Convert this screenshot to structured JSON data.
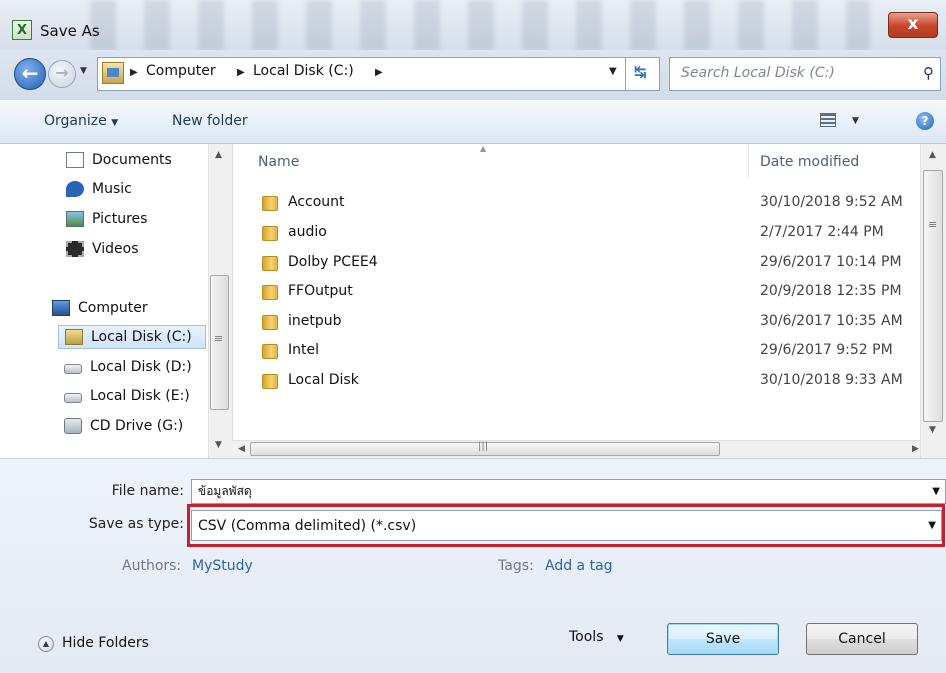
{
  "window": {
    "title": "Save As",
    "app_icon": "excel-icon",
    "close_glyph": "x"
  },
  "address": {
    "crumbs": [
      "Computer",
      "Local Disk (C:)"
    ],
    "search_placeholder": "Search Local Disk (C:)"
  },
  "toolbar": {
    "organize_label": "Organize",
    "new_folder_label": "New folder"
  },
  "navpane": {
    "libraries": [
      {
        "label": "Documents",
        "icon": "documents-icon"
      },
      {
        "label": "Music",
        "icon": "music-icon"
      },
      {
        "label": "Pictures",
        "icon": "pictures-icon"
      },
      {
        "label": "Videos",
        "icon": "videos-icon"
      }
    ],
    "computer_label": "Computer",
    "drives": [
      {
        "label": "Local Disk (C:)",
        "icon": "local-disk-icon",
        "selected": true
      },
      {
        "label": "Local Disk (D:)",
        "icon": "drive-icon",
        "selected": false
      },
      {
        "label": "Local Disk (E:)",
        "icon": "drive-icon",
        "selected": false
      },
      {
        "label": "CD Drive (G:)",
        "icon": "cd-drive-icon",
        "selected": false
      }
    ]
  },
  "filelist": {
    "columns": {
      "name": "Name",
      "date_modified": "Date modified"
    },
    "rows": [
      {
        "name": "Account",
        "date": "30/10/2018 9:52 AM"
      },
      {
        "name": "audio",
        "date": "2/7/2017 2:44 PM"
      },
      {
        "name": "Dolby PCEE4",
        "date": "29/6/2017 10:14 PM"
      },
      {
        "name": "FFOutput",
        "date": "20/9/2018 12:35 PM"
      },
      {
        "name": "inetpub",
        "date": "30/6/2017 10:35 AM"
      },
      {
        "name": "Intel",
        "date": "29/6/2017 9:52 PM"
      },
      {
        "name": "Local Disk",
        "date": "30/10/2018 9:33 AM"
      }
    ]
  },
  "form": {
    "file_name_label": "File name:",
    "file_name_value": "ข้อมูลพัสดุ",
    "save_type_label": "Save as type:",
    "save_type_value": "CSV (Comma delimited) (*.csv)",
    "authors_label": "Authors:",
    "authors_value": "MyStudy",
    "tags_label": "Tags:",
    "tags_value": "Add a tag"
  },
  "footer": {
    "hide_folders_label": "Hide Folders",
    "tools_label": "Tools",
    "save_label": "Save",
    "cancel_label": "Cancel"
  },
  "colors": {
    "highlight": "#c8202a",
    "link": "#2a64b0",
    "folder": "#e7b84a"
  }
}
